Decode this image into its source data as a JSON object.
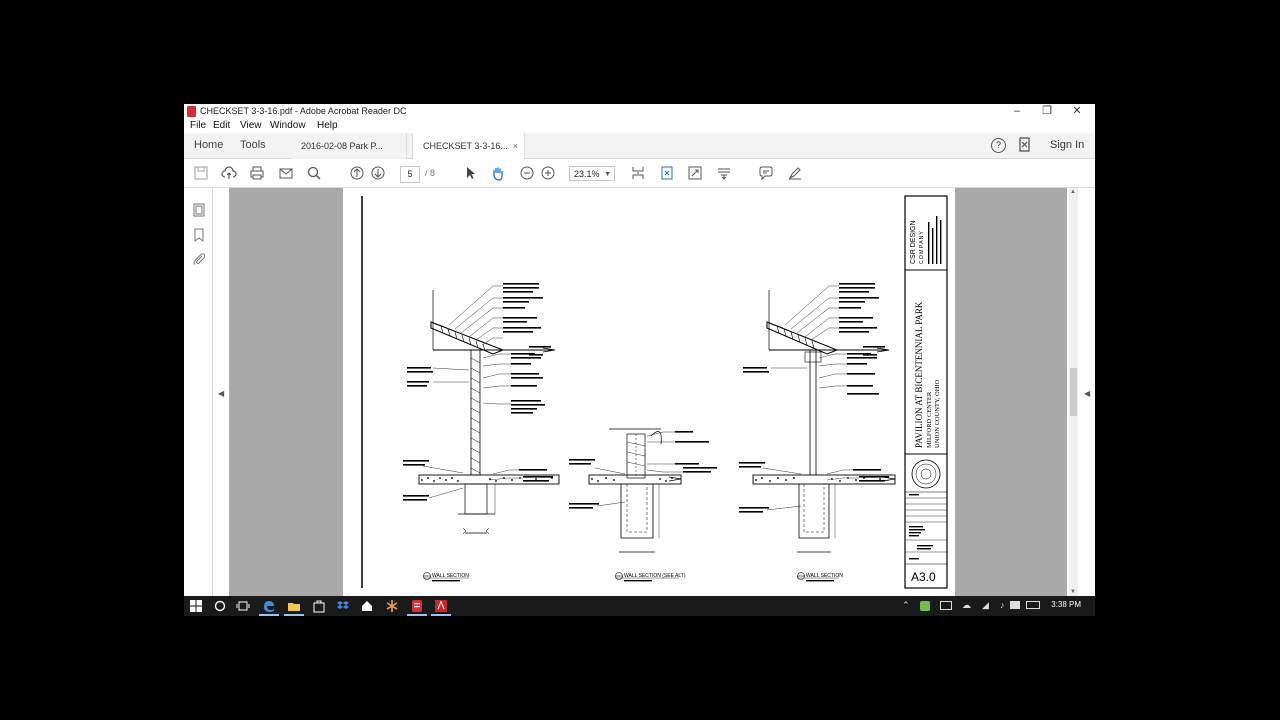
{
  "window": {
    "title": "CHECKSET 3-3-16.pdf - Adobe Acrobat Reader DC",
    "minimize": "–",
    "maximize": "❐",
    "close": "✕"
  },
  "menu": [
    "File",
    "Edit",
    "View",
    "Window",
    "Help"
  ],
  "nav": {
    "home": "Home",
    "tools": "Tools"
  },
  "tabs": [
    {
      "label": "2016-02-08 Park P...",
      "close": ""
    },
    {
      "label": "CHECKSET 3-3-16...",
      "close": "×"
    }
  ],
  "header_right": {
    "help": "?",
    "sign_in": "Sign In"
  },
  "toolbar": {
    "page_current": "5",
    "page_total": "/ 8",
    "zoom": "23.1%",
    "zoom_caret": "▼"
  },
  "sheet": {
    "firm_name": "CSR DESIGN",
    "firm_sub": "C O M P A N Y",
    "project_title": "PAVILION AT BICENTENNIAL PARK",
    "project_sub1": "MILFORD CENTER",
    "project_sub2": "UNION COUNTY, OHIO",
    "sheet_number": "A3.0",
    "sections": [
      "WALL SECTION",
      "WALL SECTION (SEE ALT)",
      "WALL SECTION"
    ]
  },
  "taskbar": {
    "clock": "3:38 PM"
  },
  "colors": {
    "canvas": "#a9a9a9",
    "taskbar": "#1a1a1a",
    "pdf_red": "#d32f2f"
  }
}
